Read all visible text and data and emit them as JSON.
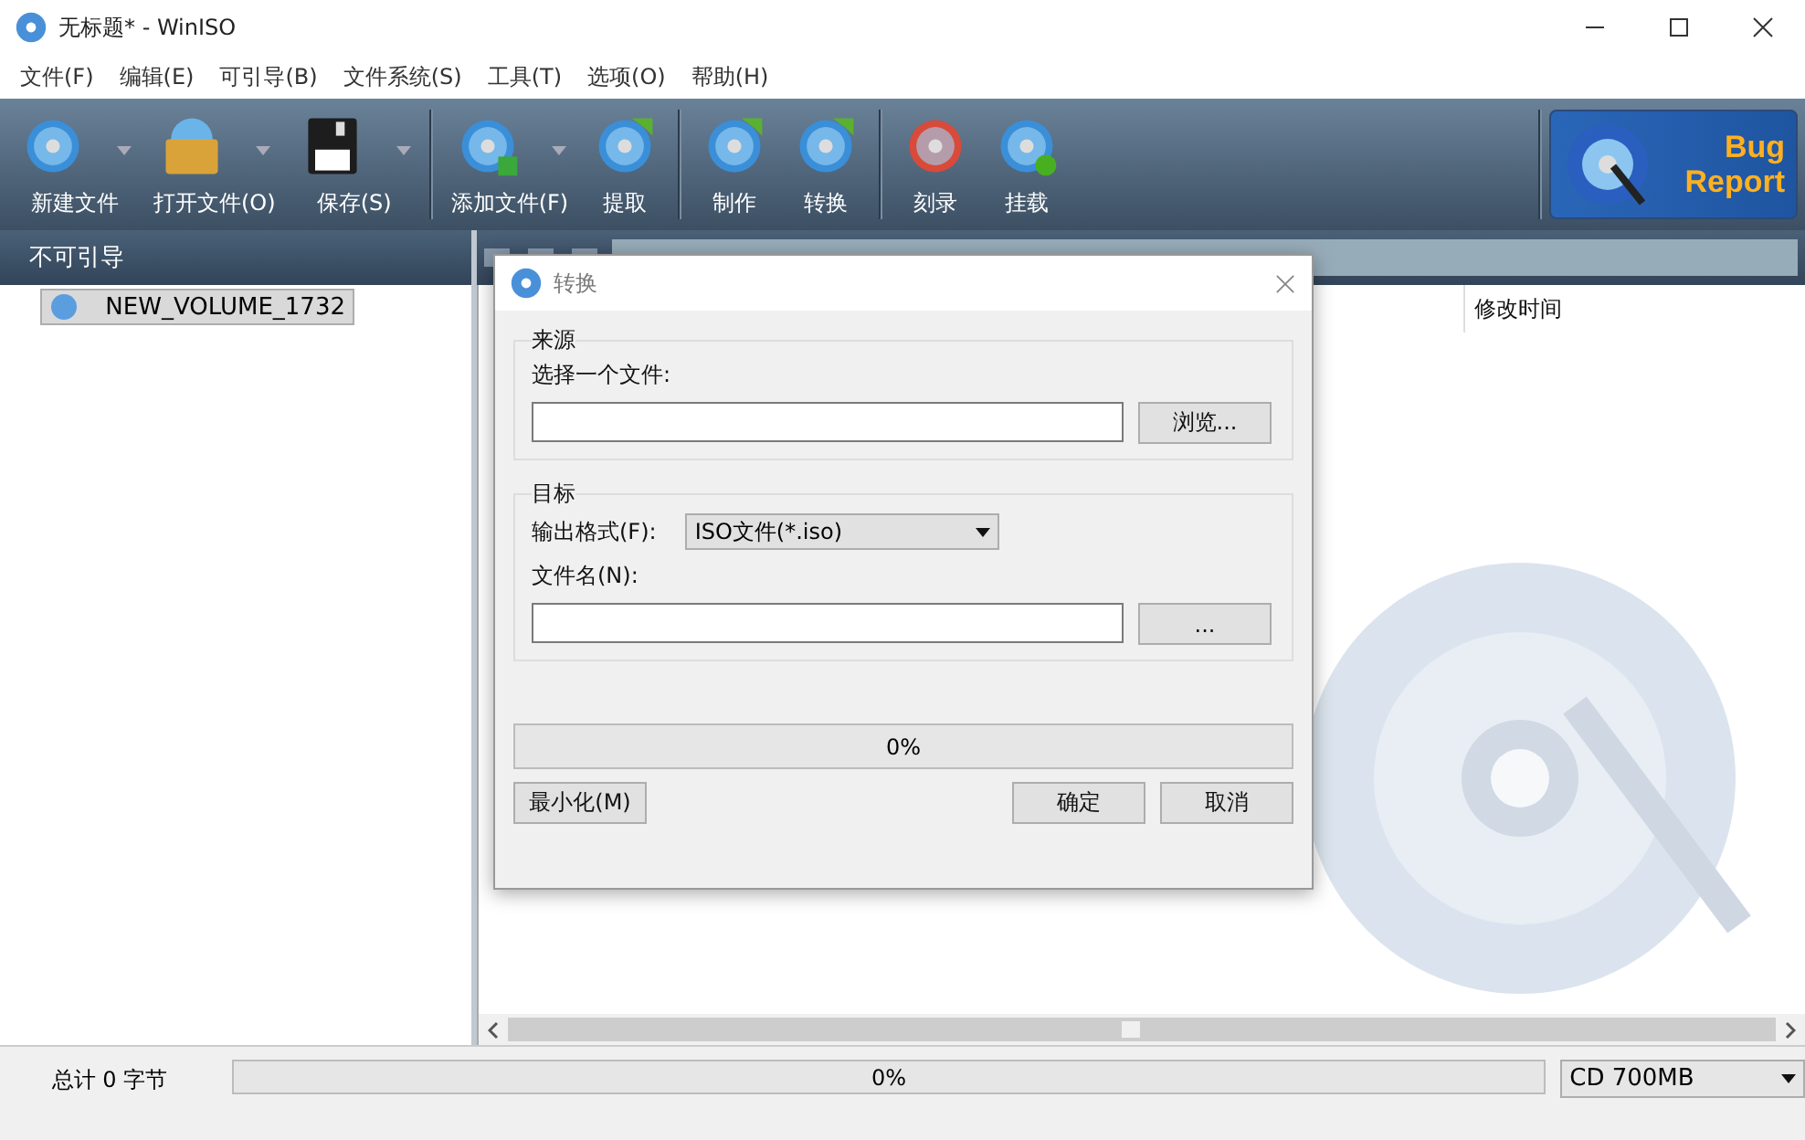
{
  "window": {
    "title": "无标题* - WinISO"
  },
  "menu": [
    "文件(F)",
    "编辑(E)",
    "可引导(B)",
    "文件系统(S)",
    "工具(T)",
    "选项(O)",
    "帮助(H)"
  ],
  "toolbar": [
    [
      {
        "label": "新建文件",
        "has_menu": true
      },
      {
        "label": "打开文件(O)",
        "has_menu": true
      },
      {
        "label": "保存(S)",
        "has_menu": true
      }
    ],
    [
      {
        "label": "添加文件(F)",
        "has_menu": true
      },
      {
        "label": "提取",
        "has_menu": false
      }
    ],
    [
      {
        "label": "制作",
        "has_menu": false
      },
      {
        "label": "转换",
        "has_menu": false
      }
    ],
    [
      {
        "label": "刻录",
        "has_menu": false
      },
      {
        "label": "挂载",
        "has_menu": false
      }
    ]
  ],
  "bug_report": {
    "lines": [
      "Bug",
      "Report"
    ]
  },
  "sidebar": {
    "header": "不可引导",
    "items": [
      {
        "label": "NEW_VOLUME_1732",
        "selected": true
      }
    ]
  },
  "file_list": {
    "columns": [
      "修改时间"
    ]
  },
  "dialog": {
    "title": "转换",
    "source": {
      "legend": "来源",
      "label": "选择一个文件:",
      "browse": "浏览..."
    },
    "target": {
      "legend": "目标",
      "format_label": "输出格式(F):",
      "format_value": "ISO文件(*.iso)",
      "filename_label": "文件名(N):",
      "browse": "..."
    },
    "progress": {
      "level": 0,
      "reading": "0%"
    },
    "buttons": [
      {
        "label": "最小化(M)",
        "kind": "left"
      },
      {
        "label": "确定",
        "kind": "right"
      },
      {
        "label": "取消",
        "kind": "right"
      }
    ]
  },
  "status_bar": {
    "total": "总计 0 字节",
    "progress": {
      "level": 0,
      "reading": "0%"
    },
    "disc_size": "CD 700MB"
  }
}
